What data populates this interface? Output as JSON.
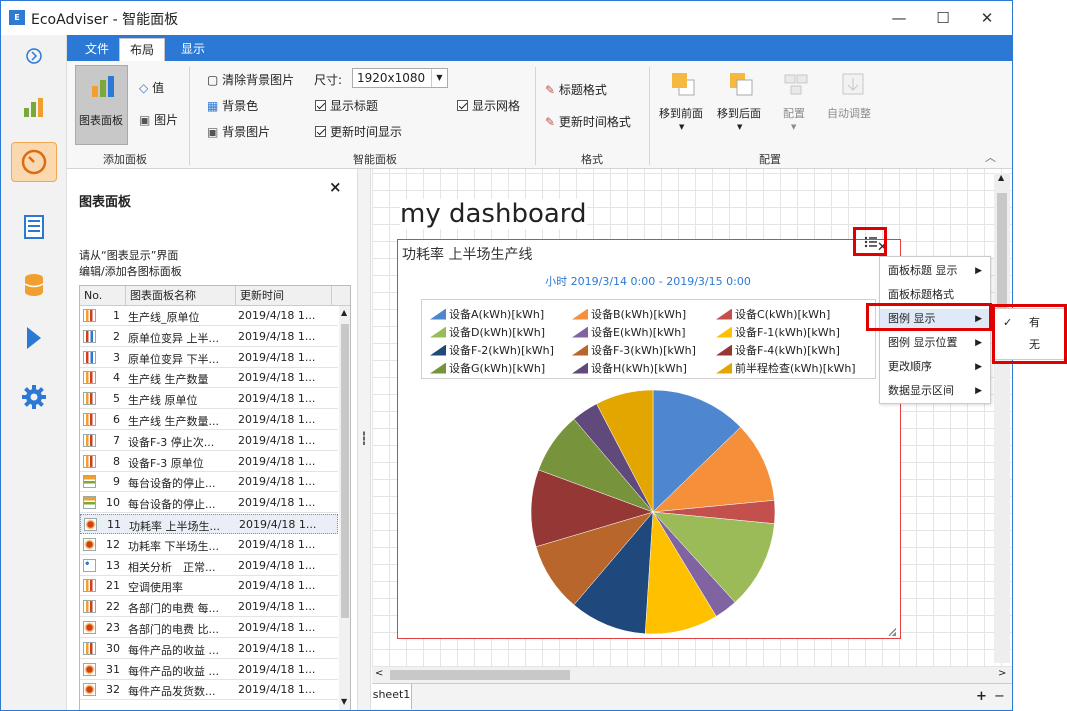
{
  "window": {
    "app": "EcoAdviser",
    "title": "EcoAdviser - 智能面板",
    "logo": "E",
    "buttons": {
      "min": "—",
      "max": "☐",
      "close": "✕"
    }
  },
  "ribbon": {
    "tabs": [
      "文件",
      "布局",
      "显示"
    ],
    "active_tab": 1,
    "chart_panel_btn": "图表面板",
    "value_btn": "值",
    "image_btn": "图片",
    "clear_bg": "清除背景图片",
    "size_label": "尺寸:",
    "size_value": "1920x1080",
    "bg_color": "背景色",
    "show_title": "显示标题",
    "bg_image": "背景图片",
    "show_update_time": "更新时间显示",
    "show_grid": "显示网格",
    "title_format": "标题格式",
    "update_time_format": "更新时间格式",
    "move_front": "移到前面",
    "move_back": "移到后面",
    "arrange": "配置",
    "auto_adjust": "自动调整",
    "groups": {
      "add_panel": "添加面板",
      "smart_panel": "智能面板",
      "format": "格式",
      "layout": "配置"
    },
    "collapse": "︿"
  },
  "left_panel": {
    "title": "图表面板",
    "close": "×",
    "note1": "请从“图表显示”界面",
    "note2": "编辑/添加各图标面板",
    "headers": [
      "No.",
      "图表面板名称",
      "更新时间"
    ],
    "rows": [
      {
        "no": "1",
        "name": "生产线_原单位",
        "time": "2019/4/18 1...",
        "icon": "bar"
      },
      {
        "no": "2",
        "name": "原单位变异 上半...",
        "time": "2019/4/18 1...",
        "icon": "box"
      },
      {
        "no": "3",
        "name": "原单位变异 下半...",
        "time": "2019/4/18 1...",
        "icon": "box"
      },
      {
        "no": "4",
        "name": "生产线 生产数量",
        "time": "2019/4/18 1...",
        "icon": "bar"
      },
      {
        "no": "5",
        "name": "生产线 原单位",
        "time": "2019/4/18 1...",
        "icon": "bar"
      },
      {
        "no": "6",
        "name": "生产线 生产数量...",
        "time": "2019/4/18 1...",
        "icon": "bar"
      },
      {
        "no": "7",
        "name": "设备F-3 停止次...",
        "time": "2019/4/18 1...",
        "icon": "bar"
      },
      {
        "no": "8",
        "name": "设备F-3 原单位",
        "time": "2019/4/18 1...",
        "icon": "bar"
      },
      {
        "no": "9",
        "name": "每台设备的停止...",
        "time": "2019/4/18 1...",
        "icon": "hbar"
      },
      {
        "no": "10",
        "name": "每台设备的停止...",
        "time": "2019/4/18 1...",
        "icon": "hbar"
      },
      {
        "no": "11",
        "name": "功耗率 上半场生...",
        "time": "2019/4/18 1...",
        "icon": "pie",
        "selected": true
      },
      {
        "no": "12",
        "name": "功耗率 下半场生...",
        "time": "2019/4/18 1...",
        "icon": "pie"
      },
      {
        "no": "13",
        "name": "相关分析　正常...",
        "time": "2019/4/18 1...",
        "icon": "scatter"
      },
      {
        "no": "21",
        "name": "空调使用率",
        "time": "2019/4/18 1...",
        "icon": "bar"
      },
      {
        "no": "22",
        "name": "各部门的电费 每...",
        "time": "2019/4/18 1...",
        "icon": "bar"
      },
      {
        "no": "23",
        "name": "各部门的电费 比...",
        "time": "2019/4/18 1...",
        "icon": "pie"
      },
      {
        "no": "30",
        "name": "每件产品的收益 ...",
        "time": "2019/4/18 1...",
        "icon": "bar"
      },
      {
        "no": "31",
        "name": "每件产品的收益 ...",
        "time": "2019/4/18 1...",
        "icon": "pie"
      },
      {
        "no": "32",
        "name": "每件产品发货数...",
        "time": "2019/4/18 1...",
        "icon": "pie"
      }
    ]
  },
  "dashboard": {
    "title": "my dashboard",
    "panel_title": "功耗率 上半场生产线",
    "close": "✕",
    "range": "小时 2019/3/14 0:00 - 2019/3/15 0:00",
    "sheet": "sheet1",
    "add_sheet": "+",
    "remove_sheet": "−"
  },
  "context_menu": {
    "items": [
      {
        "label": "面板标题 显示",
        "sub": true
      },
      {
        "label": "面板标题格式",
        "sub": false
      },
      {
        "label": "图例 显示",
        "sub": true,
        "highlight": true
      },
      {
        "label": "图例 显示位置",
        "sub": true
      },
      {
        "label": "更改顺序",
        "sub": true
      },
      {
        "label": "数据显示区间",
        "sub": true
      }
    ],
    "submenu": [
      {
        "label": "有",
        "checked": true
      },
      {
        "label": "无",
        "checked": false
      }
    ],
    "check_mark": "✓",
    "arrow": "▶"
  },
  "chart_data": {
    "type": "pie",
    "series": [
      {
        "name": "设备A(kWh)[kWh]",
        "value": 12.5,
        "color": "#4e86cf"
      },
      {
        "name": "设备B(kWh)[kWh]",
        "value": 10.5,
        "color": "#f58f3a"
      },
      {
        "name": "设备C(kWh)[kWh]",
        "value": 3.0,
        "color": "#c3504d"
      },
      {
        "name": "设备D(kWh)[kWh]",
        "value": 11.5,
        "color": "#9bbb59"
      },
      {
        "name": "设备E(kWh)[kWh]",
        "value": 3.0,
        "color": "#8064a2"
      },
      {
        "name": "设备F-1(kWh)[kWh]",
        "value": 9.5,
        "color": "#ffc000"
      },
      {
        "name": "设备F-2(kWh)[kWh]",
        "value": 10.0,
        "color": "#1f497d"
      },
      {
        "name": "设备F-3(kWh)[kWh]",
        "value": 9.0,
        "color": "#b8662b"
      },
      {
        "name": "设备F-4(kWh)[kWh]",
        "value": 10.0,
        "color": "#953735"
      },
      {
        "name": "设备G(kWh)[kWh]",
        "value": 8.0,
        "color": "#77933c"
      },
      {
        "name": "设备H(kWh)[kWh]",
        "value": 3.5,
        "color": "#604a7b"
      },
      {
        "name": "前半程检查(kWh)[kWh]",
        "value": 7.5,
        "color": "#e3a600"
      }
    ],
    "legend_position": "top"
  }
}
